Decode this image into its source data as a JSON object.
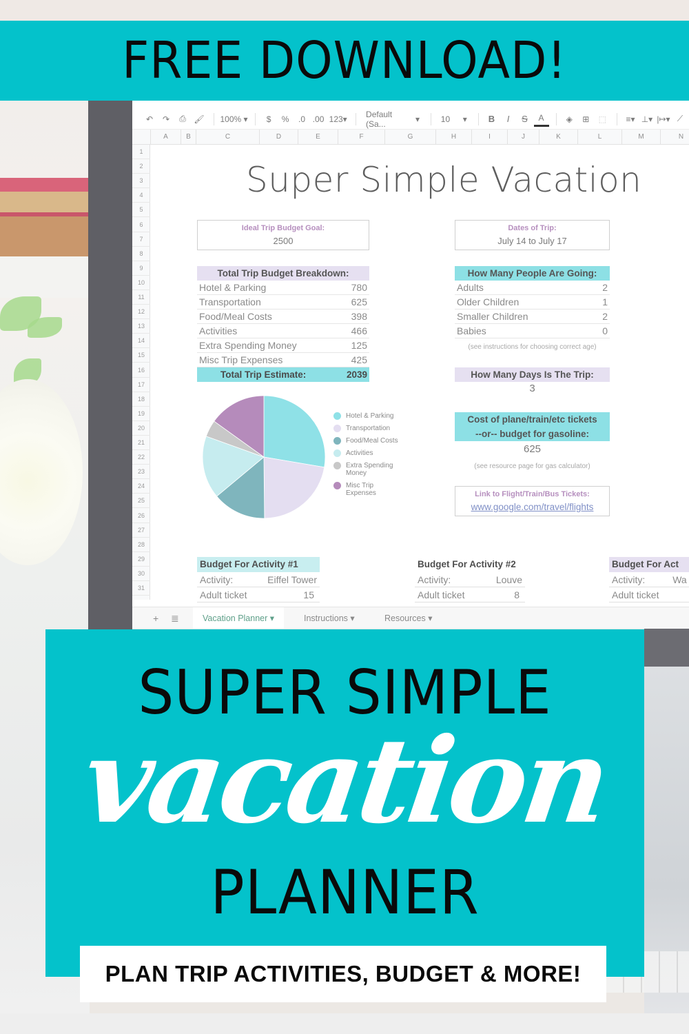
{
  "banner_top": {
    "text": "FREE DOWNLOAD!"
  },
  "spreadsheet": {
    "toolbar": {
      "undo": "↶",
      "redo": "↷",
      "print": "⎙",
      "paint_format": "🖌",
      "zoom": "100%",
      "currency": "$",
      "percent": "%",
      "decrease_decimal": ".0",
      "increase_decimal": ".00",
      "number_format": "123",
      "font": "Default (Sa...",
      "font_size": "10",
      "bold": "B",
      "italic": "I",
      "strikethrough": "S",
      "text_color": "A"
    },
    "columns": [
      "A",
      "B",
      "C",
      "D",
      "E",
      "F",
      "G",
      "H",
      "I",
      "J",
      "K",
      "L",
      "M",
      "N"
    ],
    "rows": [
      "1",
      "2",
      "3",
      "4",
      "5",
      "6",
      "7",
      "8",
      "9",
      "10",
      "11",
      "12",
      "13",
      "14",
      "15",
      "16",
      "17",
      "18",
      "19",
      "20",
      "21",
      "22",
      "23",
      "24",
      "25",
      "26",
      "27",
      "28",
      "29",
      "30",
      "31"
    ],
    "title": "Super Simple Vacation",
    "budget_goal": {
      "label": "Ideal Trip Budget Goal:",
      "value": "2500"
    },
    "dates": {
      "label": "Dates of Trip:",
      "value": "July 14 to July 17"
    },
    "breakdown": {
      "header": "Total Trip Budget Breakdown:",
      "rows": [
        {
          "label": "Hotel & Parking",
          "value": "780"
        },
        {
          "label": "Transportation",
          "value": "625"
        },
        {
          "label": "Food/Meal Costs",
          "value": "398"
        },
        {
          "label": "Activities",
          "value": "466"
        },
        {
          "label": "Extra Spending Money",
          "value": "125"
        },
        {
          "label": "Misc Trip Expenses",
          "value": "425"
        }
      ],
      "total_label": "Total Trip Estimate:",
      "total_value": "2039"
    },
    "people": {
      "header": "How Many People Are Going:",
      "rows": [
        {
          "label": "Adults",
          "value": "2"
        },
        {
          "label": "Older Children",
          "value": "1"
        },
        {
          "label": "Smaller Children",
          "value": "2"
        },
        {
          "label": "Babies",
          "value": "0"
        }
      ],
      "note": "(see instructions for choosing correct age)"
    },
    "days": {
      "label": "How Many Days Is The Trip:",
      "value": "3"
    },
    "tickets": {
      "label_line1": "Cost of plane/train/etc tickets",
      "label_line2": "--or-- budget for gasoline:",
      "value": "625",
      "note": "(see resource page for gas calculator)"
    },
    "link": {
      "label": "Link to Flight/Train/Bus Tickets:",
      "url_text": "www.google.com/travel/flights"
    },
    "activities": [
      {
        "header": "Budget For Activity #1",
        "activity_label": "Activity:",
        "activity_value": "Eiffel Tower",
        "ticket_label": "Adult ticket",
        "ticket_value": "15"
      },
      {
        "header": "Budget For Activity #2",
        "activity_label": "Activity:",
        "activity_value": "Louve",
        "ticket_label": "Adult ticket",
        "ticket_value": "8"
      },
      {
        "header": "Budget For Act",
        "activity_label": "Activity:",
        "activity_value": "Wa",
        "ticket_label": "Adult ticket",
        "ticket_value": ""
      }
    ],
    "tabs": {
      "add": "+",
      "all_sheets": "≣",
      "items": [
        {
          "label": "Vacation Planner ▾"
        },
        {
          "label": "Instructions ▾"
        },
        {
          "label": "Resources ▾"
        }
      ]
    }
  },
  "chart_data": {
    "type": "pie",
    "title": "",
    "categories": [
      "Hotel & Parking",
      "Transportation",
      "Food/Meal Costs",
      "Activities",
      "Extra Spending Money",
      "Misc Trip Expenses"
    ],
    "values": [
      780,
      625,
      398,
      466,
      125,
      425
    ],
    "colors": [
      "#8fe1e7",
      "#e4def1",
      "#7fb5bd",
      "#c6ecef",
      "#c8c8c8",
      "#b58bbb"
    ],
    "legend_position": "right",
    "legend": [
      {
        "label": "Hotel & Parking"
      },
      {
        "label": "Transportation"
      },
      {
        "label": "Food/Meal Costs"
      },
      {
        "label": "Activities"
      },
      {
        "label": "Extra Spending Money"
      },
      {
        "label": "Misc Trip Expenses"
      }
    ]
  },
  "banner_main": {
    "line1": "SUPER SIMPLE",
    "script": "vacation",
    "line3": "PLANNER",
    "tagline": "PLAN TRIP ACTIVITIES, BUDGET & MORE!"
  },
  "colors": {
    "brand_teal": "#04c2cb",
    "label_purple": "#b68fbe",
    "header_lavender": "#e6e0f1",
    "header_teal": "#8de0e5"
  }
}
